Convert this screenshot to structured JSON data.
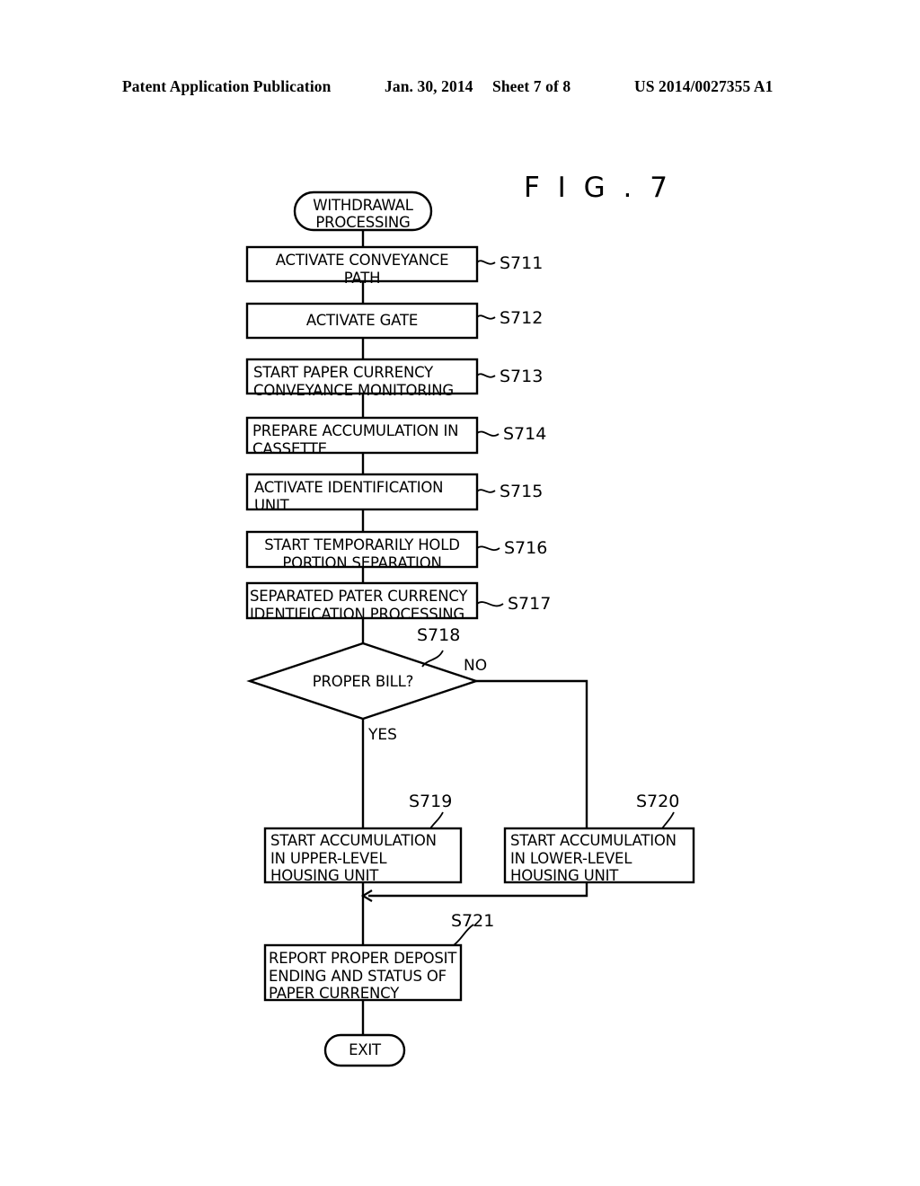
{
  "header": {
    "publication": "Patent Application Publication",
    "date": "Jan. 30, 2014",
    "sheet": "Sheet 7 of 8",
    "patent_number": "US 2014/0027355 A1"
  },
  "figure": {
    "title": "F I G . 7"
  },
  "flowchart": {
    "start_terminal": {
      "label": "WITHDRAWAL\nPROCESSING",
      "shape": "stadium"
    },
    "end_terminal": {
      "label": "EXIT",
      "shape": "stadium"
    },
    "steps": [
      {
        "id": "S711",
        "label": "ACTIVATE CONVEYANCE\nPATH",
        "align": "center-first"
      },
      {
        "id": "S712",
        "label": "ACTIVATE GATE",
        "align": "center"
      },
      {
        "id": "S713",
        "label": "START PAPER CURRENCY\nCONVEYANCE MONITORING",
        "align": "left"
      },
      {
        "id": "S714",
        "label": "PREPARE ACCUMULATION IN\nCASSETTE",
        "align": "left"
      },
      {
        "id": "S715",
        "label": "ACTIVATE IDENTIFICATION\nUNIT",
        "align": "left"
      },
      {
        "id": "S716",
        "label": "START TEMPORARILY HOLD\nPORTION SEPARATION",
        "align": "center-first"
      },
      {
        "id": "S717",
        "label": "SEPARATED PATER CURRENCY\nIDENTIFICATION PROCESSING",
        "align": "left"
      }
    ],
    "decision": {
      "id": "S718",
      "label": "PROPER BILL?",
      "yes_label": "YES",
      "no_label": "NO"
    },
    "branch_steps": [
      {
        "id": "S719",
        "label": "START ACCUMULATION\nIN UPPER-LEVEL\nHOUSING UNIT",
        "branch": "yes"
      },
      {
        "id": "S720",
        "label": "START ACCUMULATION\nIN LOWER-LEVEL\nHOUSING UNIT",
        "branch": "no"
      }
    ],
    "merge_step": {
      "id": "S721",
      "label": "REPORT PROPER DEPOSIT\nENDING AND STATUS OF\nPAPER CURRENCY"
    }
  },
  "colors": {
    "ink": "#000000",
    "paper": "#ffffff"
  }
}
